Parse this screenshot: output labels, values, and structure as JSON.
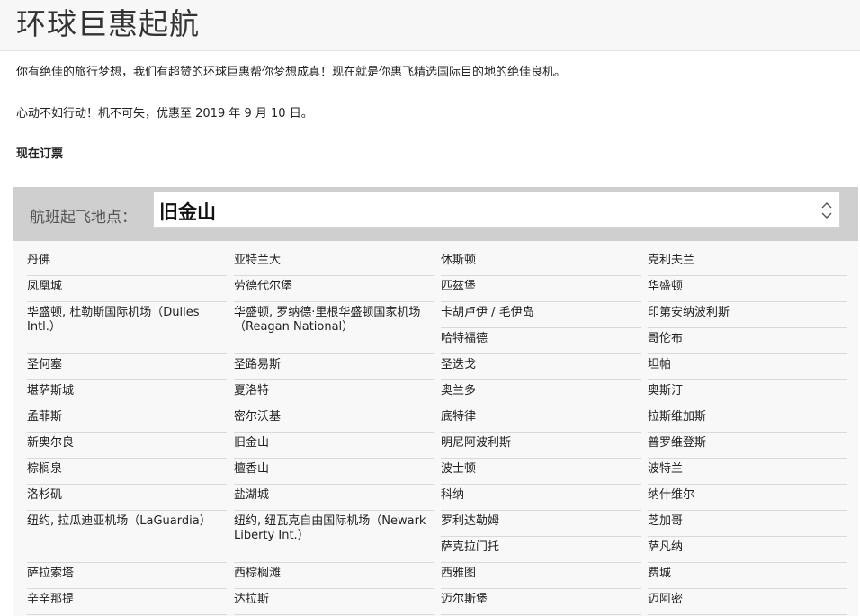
{
  "page": {
    "title": "环球巨惠起航",
    "intro": "你有绝佳的旅行梦想，我们有超赞的环球巨惠帮你梦想成真！现在就是你惠飞精选国际目的地的绝佳良机。",
    "deadline": "心动不如行动！机不可失，优惠至 2019 年 9 月 10 日。",
    "book_now": "现在订票"
  },
  "origin": {
    "label": "航班起飞地点：",
    "selected": "旧金山",
    "icon": "updown-chevron-icon"
  },
  "cities": [
    [
      "丹佛",
      "亚特兰大",
      "休斯顿",
      "克利夫兰"
    ],
    [
      "凤凰城",
      "劳德代尔堡",
      "匹兹堡",
      "华盛顿"
    ],
    [
      "华盛顿, 杜勒斯国际机场（Dulles Intl.）",
      "华盛顿, 罗纳德·里根华盛顿国家机场（Reagan National）",
      "卡胡卢伊 / 毛伊岛",
      "印第安纳波利斯"
    ],
    [
      "",
      "",
      "哈特福德",
      "哥伦布"
    ],
    [
      "圣何塞",
      "圣路易斯",
      "圣迭戈",
      "坦帕"
    ],
    [
      "堪萨斯城",
      "夏洛特",
      "奥兰多",
      "奥斯汀"
    ],
    [
      "孟菲斯",
      "密尔沃基",
      "底特律",
      "拉斯维加斯"
    ],
    [
      "新奥尔良",
      "旧金山",
      "明尼阿波利斯",
      "普罗维登斯"
    ],
    [
      "棕榈泉",
      "檀香山",
      "波士顿",
      "波特兰"
    ],
    [
      "洛杉矶",
      "盐湖城",
      "科纳",
      "纳什维尔"
    ],
    [
      "纽约, 拉瓜迪亚机场（LaGuardia）",
      "纽约, 纽瓦克自由国际机场（Newark Liberty Int.）",
      "罗利达勒姆",
      "芝加哥"
    ],
    [
      "",
      "",
      "萨克拉门托",
      "萨凡纳"
    ],
    [
      "萨拉索塔",
      "西棕榈滩",
      "西雅图",
      "费城"
    ],
    [
      "辛辛那提",
      "达拉斯",
      "迈尔斯堡",
      "迈阿密"
    ]
  ]
}
